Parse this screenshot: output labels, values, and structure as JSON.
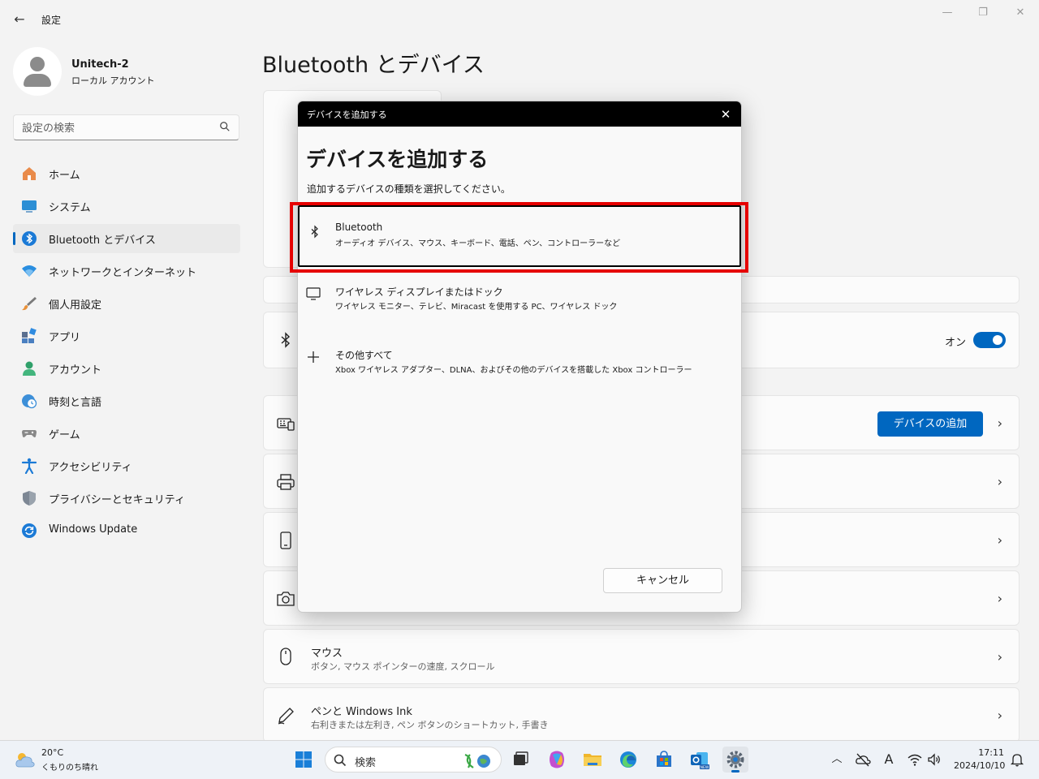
{
  "window": {
    "title": "設定",
    "back_glyph": "←",
    "min_glyph": "—",
    "max_glyph": "❐",
    "close_glyph": "✕"
  },
  "profile": {
    "name": "Unitech-2",
    "type": "ローカル アカウント"
  },
  "search": {
    "placeholder": "設定の検索"
  },
  "nav": {
    "items": [
      {
        "label": "ホーム",
        "icon": "home-icon"
      },
      {
        "label": "システム",
        "icon": "monitor-icon"
      },
      {
        "label": "Bluetooth とデバイス",
        "icon": "bluetooth-icon",
        "active": true
      },
      {
        "label": "ネットワークとインターネット",
        "icon": "wifi-icon"
      },
      {
        "label": "個人用設定",
        "icon": "brush-icon"
      },
      {
        "label": "アプリ",
        "icon": "apps-icon"
      },
      {
        "label": "アカウント",
        "icon": "account-icon"
      },
      {
        "label": "時刻と言語",
        "icon": "clock-globe-icon"
      },
      {
        "label": "ゲーム",
        "icon": "gamepad-icon"
      },
      {
        "label": "アクセシビリティ",
        "icon": "accessibility-icon"
      },
      {
        "label": "プライバシーとセキュリティ",
        "icon": "shield-icon"
      },
      {
        "label": "Windows Update",
        "icon": "update-icon"
      }
    ]
  },
  "main": {
    "title": "Bluetooth とデバイス",
    "bluetooth_toggle": {
      "label": "オン",
      "on": true
    },
    "add_device_button": "デバイスの追加",
    "mouse_row": {
      "title": "マウス",
      "subtitle": "ボタン, マウス ポインターの速度, スクロール"
    },
    "pen_row": {
      "title": "ペンと Windows Ink",
      "subtitle": "右利きまたは左利き, ペン ボタンのショートカット, 手書き"
    }
  },
  "dialog": {
    "titlebar": "デバイスを追加する",
    "heading": "デバイスを追加する",
    "description": "追加するデバイスの種類を選択してください。",
    "options": [
      {
        "title": "Bluetooth",
        "subtitle": "オーディオ デバイス、マウス、キーボード、電話、ペン、コントローラーなど",
        "icon": "bluetooth-icon"
      },
      {
        "title": "ワイヤレス ディスプレイまたはドック",
        "subtitle": "ワイヤレス モニター、テレビ、Miracast を使用する PC、ワイヤレス ドック",
        "icon": "monitor-icon"
      },
      {
        "title": "その他すべて",
        "subtitle": "Xbox ワイヤレス アダプター、DLNA、およびその他のデバイスを搭載した Xbox コントローラー",
        "icon": "plus-icon"
      }
    ],
    "cancel": "キャンセル"
  },
  "taskbar": {
    "weather": {
      "temp": "20°C",
      "desc": "くもりのち晴れ"
    },
    "search_label": "検索",
    "tray": {
      "ime": "A"
    },
    "clock": {
      "time": "17:11",
      "date": "2024/10/10"
    }
  },
  "colors": {
    "accent": "#0067c0",
    "highlight": "#e60000"
  }
}
